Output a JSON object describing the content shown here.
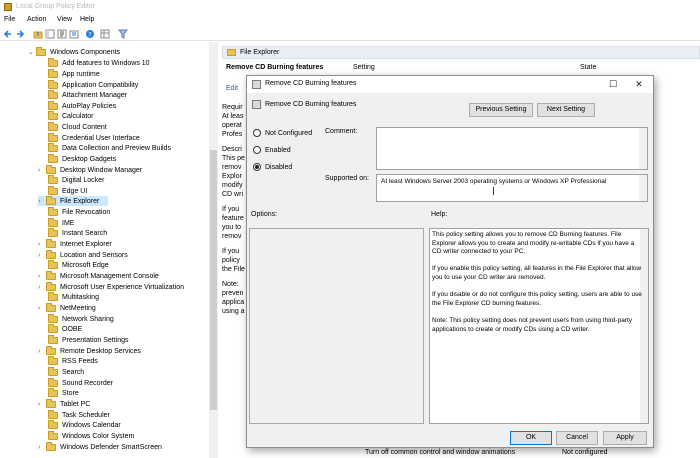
{
  "window": {
    "title": "Local Group Policy Editor"
  },
  "menu": [
    "File",
    "Action",
    "View",
    "Help"
  ],
  "tree": {
    "items": [
      {
        "label": "Windows Components",
        "expanded": true,
        "level": 0
      },
      {
        "label": "Add features to Windows 10",
        "level": 1
      },
      {
        "label": "App runtime",
        "level": 1
      },
      {
        "label": "Application Compatibility",
        "level": 1
      },
      {
        "label": "Attachment Manager",
        "level": 1
      },
      {
        "label": "AutoPlay Policies",
        "level": 1
      },
      {
        "label": "Calculator",
        "level": 1
      },
      {
        "label": "Cloud Content",
        "level": 1
      },
      {
        "label": "Credential User Interface",
        "level": 1
      },
      {
        "label": "Data Collection and Preview Builds",
        "level": 1
      },
      {
        "label": "Desktop Gadgets",
        "level": 1
      },
      {
        "label": "Desktop Window Manager",
        "level": 1,
        "collapsed": true
      },
      {
        "label": "Digital Locker",
        "level": 1
      },
      {
        "label": "Edge UI",
        "level": 1
      },
      {
        "label": "File Explorer",
        "level": 1,
        "collapsed": true,
        "selected": true
      },
      {
        "label": "File Revocation",
        "level": 1
      },
      {
        "label": "IME",
        "level": 1
      },
      {
        "label": "Instant Search",
        "level": 1
      },
      {
        "label": "Internet Explorer",
        "level": 1,
        "collapsed": true
      },
      {
        "label": "Location and Sensors",
        "level": 1,
        "collapsed": true
      },
      {
        "label": "Microsoft Edge",
        "level": 1
      },
      {
        "label": "Microsoft Management Console",
        "level": 1,
        "collapsed": true
      },
      {
        "label": "Microsoft User Experience Virtualization",
        "level": 1,
        "collapsed": true
      },
      {
        "label": "Multitasking",
        "level": 1
      },
      {
        "label": "NetMeeting",
        "level": 1,
        "collapsed": true
      },
      {
        "label": "Network Sharing",
        "level": 1
      },
      {
        "label": "OOBE",
        "level": 1
      },
      {
        "label": "Presentation Settings",
        "level": 1
      },
      {
        "label": "Remote Desktop Services",
        "level": 1,
        "collapsed": true
      },
      {
        "label": "RSS Feeds",
        "level": 1
      },
      {
        "label": "Search",
        "level": 1
      },
      {
        "label": "Sound Recorder",
        "level": 1
      },
      {
        "label": "Store",
        "level": 1
      },
      {
        "label": "Tablet PC",
        "level": 1,
        "collapsed": true
      },
      {
        "label": "Task Scheduler",
        "level": 1
      },
      {
        "label": "Windows Calendar",
        "level": 1
      },
      {
        "label": "Windows Color System",
        "level": 1
      },
      {
        "label": "Windows Defender SmartScreen",
        "level": 1,
        "collapsed": true
      }
    ]
  },
  "right_pane": {
    "header": "File Explorer",
    "policy_title": "Remove CD Burning features",
    "columns": [
      "Setting",
      "State"
    ],
    "edit_prefix": "Edit",
    "desc_fragments": [
      "Requir",
      "At leas",
      "operat",
      "Profes",
      "Descri",
      "This pe",
      "remov",
      "Explor",
      "modify",
      "CD wri",
      "If you",
      "feature",
      "you to",
      "remov",
      "If you",
      "policy",
      "the File",
      "Note:",
      "preven",
      "applica",
      "using a"
    ],
    "bottom_row_setting": "Turn off common control and window animations",
    "bottom_row_state": "Not configured"
  },
  "dialog": {
    "title": "Remove CD Burning features",
    "subtitle": "Remove CD Burning features",
    "prev_label": "Previous Setting",
    "next_label": "Next Setting",
    "radio_not_configured": "Not Configured",
    "radio_enabled": "Enabled",
    "radio_disabled": "Disabled",
    "selected": "Disabled",
    "comment_label": "Comment:",
    "supported_label": "Supported on:",
    "supported_value": "At least Windows Server 2003 operating systems or Windows XP Professional",
    "options_label": "Options:",
    "help_label": "Help:",
    "help_paragraphs": [
      "This policy setting allows you to remove CD Burning features. File Explorer allows you to create and modify re-writable CDs if you have a CD writer connected to your PC.",
      "If you enable this policy setting, all features in the File Explorer that allow you to use your CD writer are removed.",
      "If you disable or do not configure this policy setting, users are able to use the File Explorer CD burning features.",
      "Note: This policy setting does not prevent users from using third-party applications to create or modify CDs using a CD writer."
    ],
    "ok_label": "OK",
    "cancel_label": "Cancel",
    "apply_label": "Apply"
  }
}
